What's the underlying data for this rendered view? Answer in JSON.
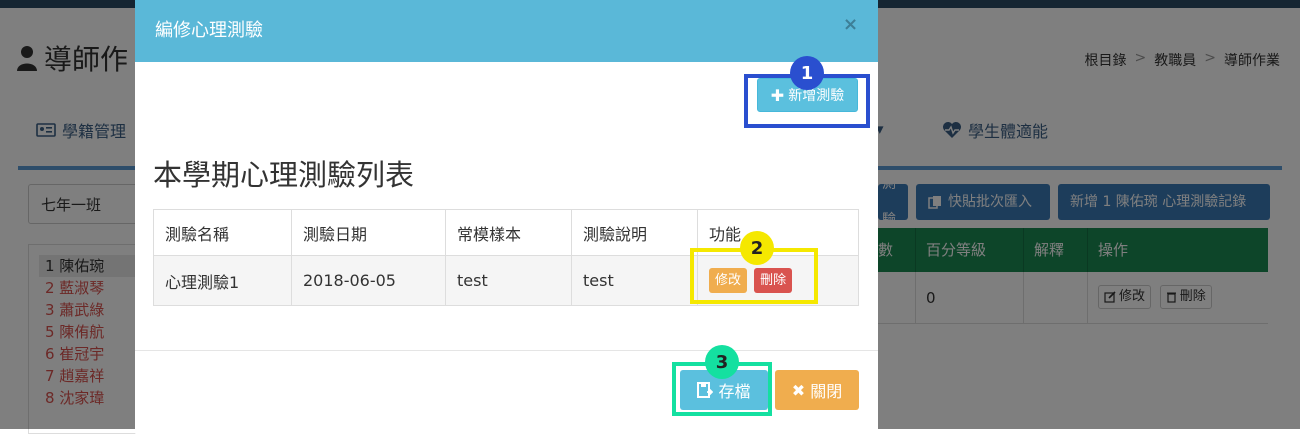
{
  "background": {
    "page_title": "導師作",
    "breadcrumb": [
      "根目錄",
      "教職員",
      "導師作業"
    ],
    "nav_items": [
      "學籍管理",
      "學生體適能"
    ],
    "class_selected": "七年一班",
    "students": [
      "1 陳佑琬",
      "2 藍淑琴",
      "3 蕭武綠",
      "5 陳侑航",
      "6 崔冠宇",
      "7 趙嘉祥",
      "8 沈家瑋"
    ],
    "buttons": [
      "測驗",
      "快貼批次匯入",
      "新增 1 陳佑琬 心理測驗記錄"
    ],
    "table_headers": [
      "數",
      "百分等級",
      "解釋",
      "操作"
    ],
    "table_row": [
      "",
      "0",
      ""
    ],
    "row_edit": "修改",
    "row_delete": "刪除"
  },
  "modal": {
    "title": "編修心理測驗",
    "close_glyph": "×",
    "add_button": "新增測驗",
    "section_heading": "本學期心理測驗列表",
    "table": {
      "headers": [
        "測驗名稱",
        "測驗日期",
        "常模樣本",
        "測驗說明",
        "功能"
      ],
      "rows": [
        {
          "name": "心理測驗1",
          "date": "2018-06-05",
          "norm": "test",
          "desc": "test",
          "edit": "修改",
          "delete": "刪除"
        }
      ]
    },
    "save_button": "存檔",
    "close_button": "關閉"
  },
  "annotations": {
    "badge1": "1",
    "badge2": "2",
    "badge3": "3",
    "colors": {
      "blue": "#2a4fcf",
      "yellow": "#f5e800",
      "green": "#14e0a0"
    }
  }
}
